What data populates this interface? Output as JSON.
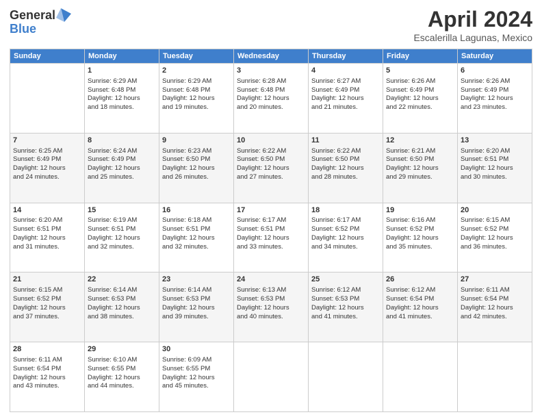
{
  "logo": {
    "line1": "General",
    "line2": "Blue"
  },
  "title": "April 2024",
  "subtitle": "Escalerilla Lagunas, Mexico",
  "weekdays": [
    "Sunday",
    "Monday",
    "Tuesday",
    "Wednesday",
    "Thursday",
    "Friday",
    "Saturday"
  ],
  "weeks": [
    [
      {
        "day": "",
        "sunrise": "",
        "sunset": "",
        "daylight": "",
        "shade": false
      },
      {
        "day": "1",
        "sunrise": "Sunrise: 6:29 AM",
        "sunset": "Sunset: 6:48 PM",
        "daylight": "Daylight: 12 hours and 18 minutes.",
        "shade": false
      },
      {
        "day": "2",
        "sunrise": "Sunrise: 6:29 AM",
        "sunset": "Sunset: 6:48 PM",
        "daylight": "Daylight: 12 hours and 19 minutes.",
        "shade": false
      },
      {
        "day": "3",
        "sunrise": "Sunrise: 6:28 AM",
        "sunset": "Sunset: 6:48 PM",
        "daylight": "Daylight: 12 hours and 20 minutes.",
        "shade": false
      },
      {
        "day": "4",
        "sunrise": "Sunrise: 6:27 AM",
        "sunset": "Sunset: 6:49 PM",
        "daylight": "Daylight: 12 hours and 21 minutes.",
        "shade": false
      },
      {
        "day": "5",
        "sunrise": "Sunrise: 6:26 AM",
        "sunset": "Sunset: 6:49 PM",
        "daylight": "Daylight: 12 hours and 22 minutes.",
        "shade": false
      },
      {
        "day": "6",
        "sunrise": "Sunrise: 6:26 AM",
        "sunset": "Sunset: 6:49 PM",
        "daylight": "Daylight: 12 hours and 23 minutes.",
        "shade": false
      }
    ],
    [
      {
        "day": "7",
        "sunrise": "Sunrise: 6:25 AM",
        "sunset": "Sunset: 6:49 PM",
        "daylight": "Daylight: 12 hours and 24 minutes.",
        "shade": true
      },
      {
        "day": "8",
        "sunrise": "Sunrise: 6:24 AM",
        "sunset": "Sunset: 6:49 PM",
        "daylight": "Daylight: 12 hours and 25 minutes.",
        "shade": true
      },
      {
        "day": "9",
        "sunrise": "Sunrise: 6:23 AM",
        "sunset": "Sunset: 6:50 PM",
        "daylight": "Daylight: 12 hours and 26 minutes.",
        "shade": true
      },
      {
        "day": "10",
        "sunrise": "Sunrise: 6:22 AM",
        "sunset": "Sunset: 6:50 PM",
        "daylight": "Daylight: 12 hours and 27 minutes.",
        "shade": true
      },
      {
        "day": "11",
        "sunrise": "Sunrise: 6:22 AM",
        "sunset": "Sunset: 6:50 PM",
        "daylight": "Daylight: 12 hours and 28 minutes.",
        "shade": true
      },
      {
        "day": "12",
        "sunrise": "Sunrise: 6:21 AM",
        "sunset": "Sunset: 6:50 PM",
        "daylight": "Daylight: 12 hours and 29 minutes.",
        "shade": true
      },
      {
        "day": "13",
        "sunrise": "Sunrise: 6:20 AM",
        "sunset": "Sunset: 6:51 PM",
        "daylight": "Daylight: 12 hours and 30 minutes.",
        "shade": true
      }
    ],
    [
      {
        "day": "14",
        "sunrise": "Sunrise: 6:20 AM",
        "sunset": "Sunset: 6:51 PM",
        "daylight": "Daylight: 12 hours and 31 minutes.",
        "shade": false
      },
      {
        "day": "15",
        "sunrise": "Sunrise: 6:19 AM",
        "sunset": "Sunset: 6:51 PM",
        "daylight": "Daylight: 12 hours and 32 minutes.",
        "shade": false
      },
      {
        "day": "16",
        "sunrise": "Sunrise: 6:18 AM",
        "sunset": "Sunset: 6:51 PM",
        "daylight": "Daylight: 12 hours and 32 minutes.",
        "shade": false
      },
      {
        "day": "17",
        "sunrise": "Sunrise: 6:17 AM",
        "sunset": "Sunset: 6:51 PM",
        "daylight": "Daylight: 12 hours and 33 minutes.",
        "shade": false
      },
      {
        "day": "18",
        "sunrise": "Sunrise: 6:17 AM",
        "sunset": "Sunset: 6:52 PM",
        "daylight": "Daylight: 12 hours and 34 minutes.",
        "shade": false
      },
      {
        "day": "19",
        "sunrise": "Sunrise: 6:16 AM",
        "sunset": "Sunset: 6:52 PM",
        "daylight": "Daylight: 12 hours and 35 minutes.",
        "shade": false
      },
      {
        "day": "20",
        "sunrise": "Sunrise: 6:15 AM",
        "sunset": "Sunset: 6:52 PM",
        "daylight": "Daylight: 12 hours and 36 minutes.",
        "shade": false
      }
    ],
    [
      {
        "day": "21",
        "sunrise": "Sunrise: 6:15 AM",
        "sunset": "Sunset: 6:52 PM",
        "daylight": "Daylight: 12 hours and 37 minutes.",
        "shade": true
      },
      {
        "day": "22",
        "sunrise": "Sunrise: 6:14 AM",
        "sunset": "Sunset: 6:53 PM",
        "daylight": "Daylight: 12 hours and 38 minutes.",
        "shade": true
      },
      {
        "day": "23",
        "sunrise": "Sunrise: 6:14 AM",
        "sunset": "Sunset: 6:53 PM",
        "daylight": "Daylight: 12 hours and 39 minutes.",
        "shade": true
      },
      {
        "day": "24",
        "sunrise": "Sunrise: 6:13 AM",
        "sunset": "Sunset: 6:53 PM",
        "daylight": "Daylight: 12 hours and 40 minutes.",
        "shade": true
      },
      {
        "day": "25",
        "sunrise": "Sunrise: 6:12 AM",
        "sunset": "Sunset: 6:53 PM",
        "daylight": "Daylight: 12 hours and 41 minutes.",
        "shade": true
      },
      {
        "day": "26",
        "sunrise": "Sunrise: 6:12 AM",
        "sunset": "Sunset: 6:54 PM",
        "daylight": "Daylight: 12 hours and 41 minutes.",
        "shade": true
      },
      {
        "day": "27",
        "sunrise": "Sunrise: 6:11 AM",
        "sunset": "Sunset: 6:54 PM",
        "daylight": "Daylight: 12 hours and 42 minutes.",
        "shade": true
      }
    ],
    [
      {
        "day": "28",
        "sunrise": "Sunrise: 6:11 AM",
        "sunset": "Sunset: 6:54 PM",
        "daylight": "Daylight: 12 hours and 43 minutes.",
        "shade": false
      },
      {
        "day": "29",
        "sunrise": "Sunrise: 6:10 AM",
        "sunset": "Sunset: 6:55 PM",
        "daylight": "Daylight: 12 hours and 44 minutes.",
        "shade": false
      },
      {
        "day": "30",
        "sunrise": "Sunrise: 6:09 AM",
        "sunset": "Sunset: 6:55 PM",
        "daylight": "Daylight: 12 hours and 45 minutes.",
        "shade": false
      },
      {
        "day": "",
        "sunrise": "",
        "sunset": "",
        "daylight": "",
        "shade": false
      },
      {
        "day": "",
        "sunrise": "",
        "sunset": "",
        "daylight": "",
        "shade": false
      },
      {
        "day": "",
        "sunrise": "",
        "sunset": "",
        "daylight": "",
        "shade": false
      },
      {
        "day": "",
        "sunrise": "",
        "sunset": "",
        "daylight": "",
        "shade": false
      }
    ]
  ]
}
